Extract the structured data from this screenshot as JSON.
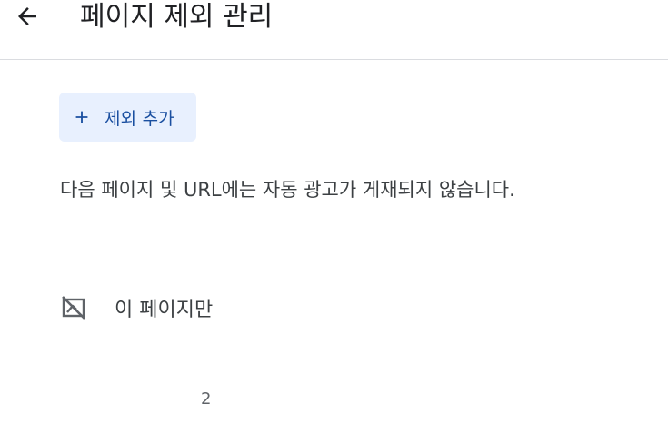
{
  "header": {
    "back_icon": "arrow-left-icon",
    "title": "페이지 제외 관리"
  },
  "actions": {
    "add_exclusion_label": "제외 추가",
    "add_icon": "plus-icon",
    "accent_color": "#1a4fa0",
    "button_bg": "#e8f0fe"
  },
  "description": "다음 페이지 및 URL에는 자동 광고가 게재되지 않습니다.",
  "exclusions": {
    "items": [
      {
        "icon": "ad-off-icon",
        "label": "이 페이지만"
      }
    ],
    "count": "2"
  }
}
